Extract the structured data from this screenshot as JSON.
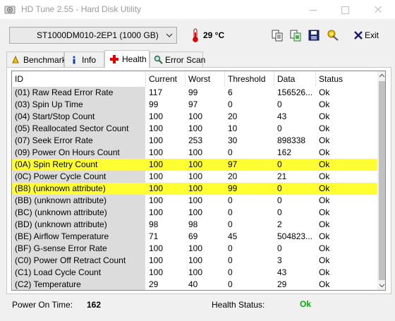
{
  "window": {
    "title": "HD Tune 2.55 - Hard Disk Utility",
    "icons": [
      "app-icon",
      "minimize-icon",
      "maximize-icon",
      "close-icon"
    ]
  },
  "toolbar": {
    "drive": "ST1000DM010-2EP1 (1000 GB)",
    "temperature": "29 °C",
    "exit_label": "Exit",
    "icons": [
      "thermometer-icon",
      "copy-text-icon",
      "copy-screenshot-icon",
      "save-icon",
      "options-icon",
      "exit-icon"
    ]
  },
  "tabs": [
    {
      "label": "Benchmark",
      "icon": "benchmark-icon"
    },
    {
      "label": "Info",
      "icon": "info-icon"
    },
    {
      "label": "Health",
      "icon": "health-cross-icon",
      "active": true
    },
    {
      "label": "Error Scan",
      "icon": "magnifier-icon"
    }
  ],
  "health_table": {
    "columns": [
      "ID",
      "Current",
      "Worst",
      "Threshold",
      "Data",
      "Status"
    ],
    "highlight_color": "#ffff31",
    "rows": [
      {
        "id": "(01) Raw Read Error Rate",
        "current": "117",
        "worst": "99",
        "threshold": "6",
        "data": "156526...",
        "status": "Ok"
      },
      {
        "id": "(03) Spin Up Time",
        "current": "99",
        "worst": "97",
        "threshold": "0",
        "data": "0",
        "status": "Ok"
      },
      {
        "id": "(04) Start/Stop Count",
        "current": "100",
        "worst": "100",
        "threshold": "20",
        "data": "43",
        "status": "Ok"
      },
      {
        "id": "(05) Reallocated Sector Count",
        "current": "100",
        "worst": "100",
        "threshold": "10",
        "data": "0",
        "status": "Ok"
      },
      {
        "id": "(07) Seek Error Rate",
        "current": "100",
        "worst": "253",
        "threshold": "30",
        "data": "898338",
        "status": "Ok"
      },
      {
        "id": "(09) Power On Hours Count",
        "current": "100",
        "worst": "100",
        "threshold": "0",
        "data": "162",
        "status": "Ok"
      },
      {
        "id": "(0A) Spin Retry Count",
        "current": "100",
        "worst": "100",
        "threshold": "97",
        "data": "0",
        "status": "Ok",
        "highlight": true
      },
      {
        "id": "(0C) Power Cycle Count",
        "current": "100",
        "worst": "100",
        "threshold": "20",
        "data": "21",
        "status": "Ok"
      },
      {
        "id": "(B8) (unknown attribute)",
        "current": "100",
        "worst": "100",
        "threshold": "99",
        "data": "0",
        "status": "Ok",
        "highlight": true
      },
      {
        "id": "(BB) (unknown attribute)",
        "current": "100",
        "worst": "100",
        "threshold": "0",
        "data": "0",
        "status": "Ok"
      },
      {
        "id": "(BC) (unknown attribute)",
        "current": "100",
        "worst": "100",
        "threshold": "0",
        "data": "0",
        "status": "Ok"
      },
      {
        "id": "(BD) (unknown attribute)",
        "current": "98",
        "worst": "98",
        "threshold": "0",
        "data": "2",
        "status": "Ok"
      },
      {
        "id": "(BE) Airflow Temperature",
        "current": "71",
        "worst": "69",
        "threshold": "45",
        "data": "504823...",
        "status": "Ok"
      },
      {
        "id": "(BF) G-sense Error Rate",
        "current": "100",
        "worst": "100",
        "threshold": "0",
        "data": "0",
        "status": "Ok"
      },
      {
        "id": "(C0) Power Off Retract Count",
        "current": "100",
        "worst": "100",
        "threshold": "0",
        "data": "3",
        "status": "Ok"
      },
      {
        "id": "(C1) Load Cycle Count",
        "current": "100",
        "worst": "100",
        "threshold": "0",
        "data": "43",
        "status": "Ok"
      },
      {
        "id": "(C2) Temperature",
        "current": "29",
        "worst": "40",
        "threshold": "0",
        "data": "29",
        "status": "Ok"
      }
    ]
  },
  "footer": {
    "power_on_label": "Power On Time:",
    "power_on_value": "162",
    "health_label": "Health Status:",
    "health_value": "Ok",
    "health_color": "#00b000"
  }
}
